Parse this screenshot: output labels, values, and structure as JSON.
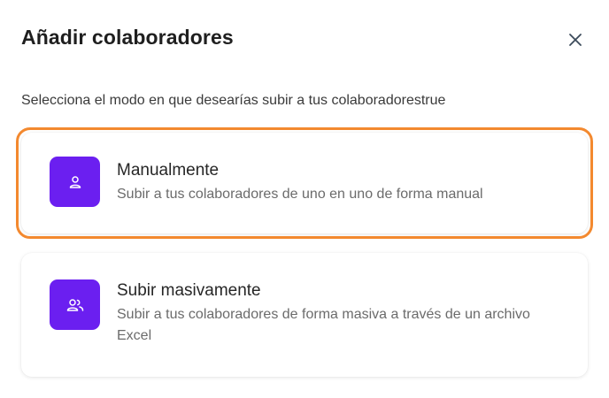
{
  "dialog": {
    "title": "Añadir colaboradores",
    "subtitle": "Selecciona el modo en que desearías subir a tus colaboradorestrue",
    "close_icon": "close-icon"
  },
  "options": [
    {
      "title": "Manualmente",
      "description": "Subir a tus colaboradores de uno en uno de forma manual",
      "icon": "user-icon",
      "highlighted": true
    },
    {
      "title": "Subir masivamente",
      "description": "Subir a tus colaboradores de forma masiva a través de un archivo Excel",
      "icon": "users-icon",
      "highlighted": false
    }
  ],
  "colors": {
    "accent": "#6b1ff0",
    "highlight": "#f3892f"
  }
}
